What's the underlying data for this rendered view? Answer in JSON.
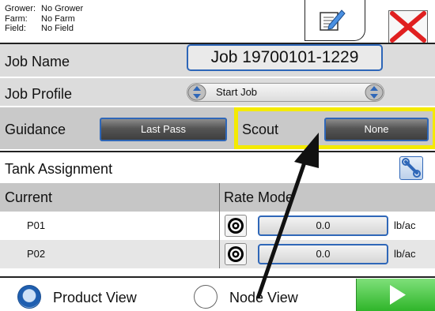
{
  "header": {
    "info": [
      {
        "key": "Grower:",
        "value": "No Grower"
      },
      {
        "key": "Farm:",
        "value": "No Farm"
      },
      {
        "key": "Field:",
        "value": "No Field"
      }
    ]
  },
  "icons": {
    "notes": "note-pencil-icon",
    "close": "close-x-icon",
    "tank": "wrench-icon",
    "target": "target-icon",
    "next": "play-arrow-icon"
  },
  "job": {
    "name_label": "Job Name",
    "name_value": "Job 19700101-1229",
    "profile_label": "Job Profile",
    "profile_value": "Start Job"
  },
  "guidance": {
    "label": "Guidance",
    "button": "Last Pass"
  },
  "scout": {
    "label": "Scout",
    "button": "None"
  },
  "tank": {
    "label": "Tank Assignment"
  },
  "table": {
    "col_current": "Current",
    "col_rate_mode": "Rate Mode",
    "rows": [
      {
        "name": "P01",
        "rate": "0.0",
        "unit": "lb/ac"
      },
      {
        "name": "P02",
        "rate": "0.0",
        "unit": "lb/ac"
      }
    ]
  },
  "view": {
    "product_label": "Product View",
    "node_label": "Node View",
    "selected": "Product View"
  },
  "colors": {
    "accent_blue": "#2f67b8",
    "highlight_yellow": "#f4ea00",
    "next_green": "#2fb52a",
    "close_red": "#e02020"
  }
}
